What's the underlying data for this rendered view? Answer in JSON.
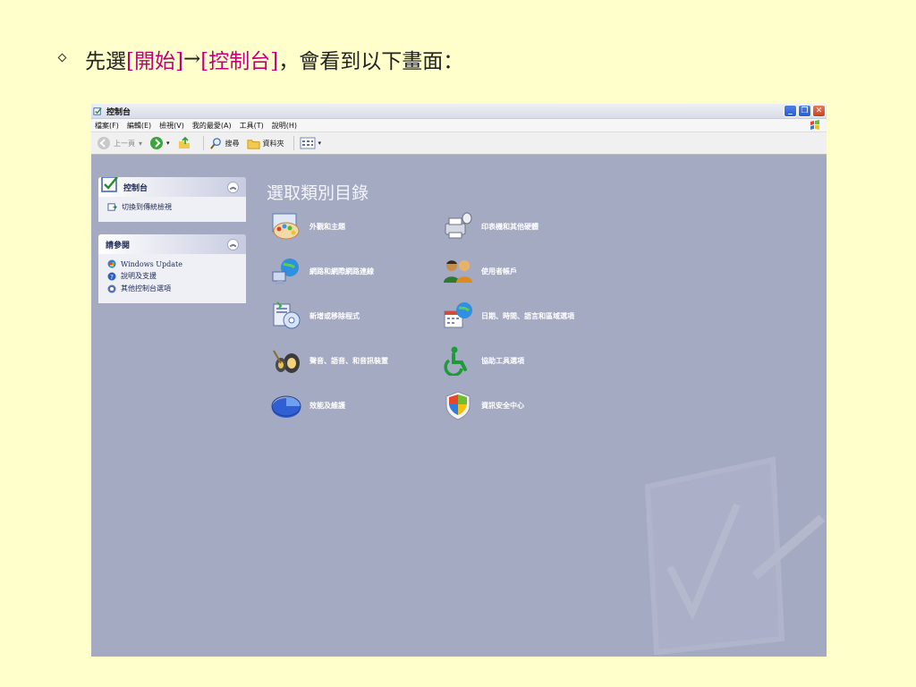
{
  "slide": {
    "bullet_glyph": "◇",
    "prefix": "先選",
    "start_label": "[開始]",
    "arrow": " → ",
    "control_panel_label": "[控制台]",
    "suffix": "，會看到以下畫面："
  },
  "window": {
    "title": "控制台",
    "buttons": {
      "minimize": "_",
      "restore": "❐",
      "close": "✕"
    }
  },
  "menubar": [
    "檔案(F)",
    "編輯(E)",
    "檢視(V)",
    "我的最愛(A)",
    "工具(T)",
    "說明(H)"
  ],
  "toolbar": {
    "back": "上一頁",
    "search": "搜尋",
    "folders": "資料夾"
  },
  "sidebar": {
    "control_panel": {
      "title": "控制台",
      "link": "切換到傳統檢視"
    },
    "see_also": {
      "title": "請參閱",
      "links": [
        "Windows Update",
        "說明及支援",
        "其他控制台選項"
      ]
    }
  },
  "main": {
    "title": "選取類別目錄",
    "categories": [
      {
        "label": "外觀和主題",
        "icon": "appearance-icon"
      },
      {
        "label": "印表機和其他硬體",
        "icon": "printer-icon"
      },
      {
        "label": "網路和網際網路連線",
        "icon": "network-icon"
      },
      {
        "label": "使用者帳戶",
        "icon": "users-icon"
      },
      {
        "label": "新增或移除程式",
        "icon": "add-remove-icon"
      },
      {
        "label": "日期、時間、語言和區域選項",
        "icon": "date-time-icon"
      },
      {
        "label": "聲音、語音、和音訊裝置",
        "icon": "sound-icon"
      },
      {
        "label": "協助工具選項",
        "icon": "accessibility-icon"
      },
      {
        "label": "效能及維護",
        "icon": "performance-icon"
      },
      {
        "label": "資訊安全中心",
        "icon": "security-shield-icon"
      }
    ]
  },
  "colors": {
    "slide_bg": "#ffffcc",
    "highlight": "#c0007a",
    "panel_bg": "#a5aac3"
  }
}
